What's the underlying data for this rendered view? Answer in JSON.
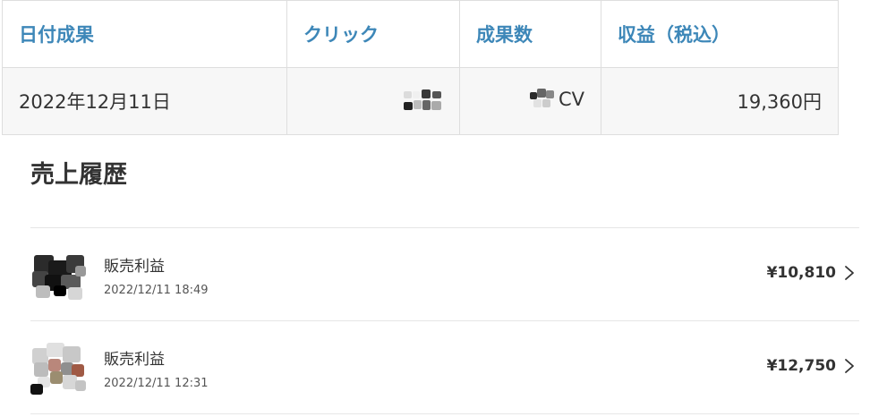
{
  "results_table": {
    "headers": {
      "date": "日付成果",
      "clicks": "クリック",
      "conversions": "成果数",
      "revenue": "収益（税込）"
    },
    "row": {
      "date": "2022年12月11日",
      "conversions_unit": "CV",
      "revenue": "19,360円"
    }
  },
  "sales_history": {
    "title": "売上履歴",
    "items": [
      {
        "label": "販売利益",
        "datetime": "2022/12/11 18:49",
        "amount": "¥10,810"
      },
      {
        "label": "販売利益",
        "datetime": "2022/12/11 12:31",
        "amount": "¥12,750"
      }
    ]
  },
  "icons": {
    "row_action": "chevron-right-icon",
    "thumbnail": "product-thumbnail"
  },
  "colors": {
    "header_text": "#3d87b8",
    "row_background": "#f7f7f7",
    "border": "#dedede",
    "text": "#333333"
  }
}
